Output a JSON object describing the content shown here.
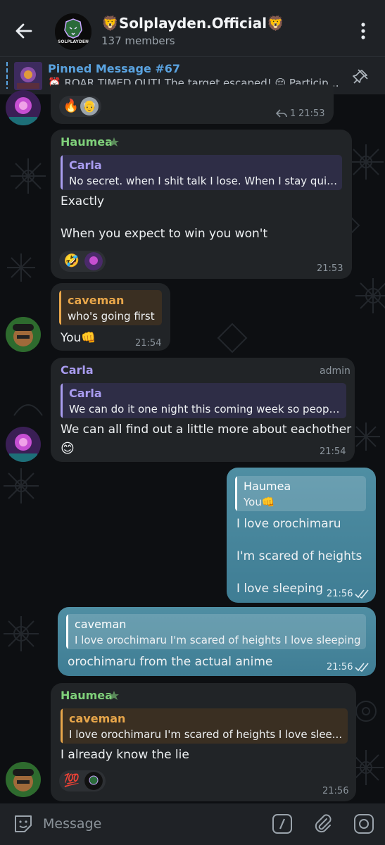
{
  "header": {
    "title": "🦁Solplayden.Official🦁",
    "members": "137 members",
    "logo_text": "SOLPLAYDEN"
  },
  "pinned": {
    "title": "Pinned Message #67",
    "text": "⏰ ROAR TIMED OUT! The target escaped! 😔 Participant..."
  },
  "messages": [
    {
      "id": "m0",
      "reactions": [
        "🔥",
        "👴"
      ],
      "reply_count": "1",
      "time": "21:53"
    },
    {
      "id": "m1",
      "sender": "Haumea",
      "quote_name": "Carla",
      "quote_text": "No secret. when I shit talk I lose. When I stay quiet...",
      "lines": [
        "Exactly",
        "When you expect to win you won't"
      ],
      "reactions": [
        "🤣"
      ],
      "time": "21:53"
    },
    {
      "id": "m2",
      "quote_name": "caveman",
      "quote_text": "who's going first",
      "text": "You👊",
      "time": "21:54"
    },
    {
      "id": "m3",
      "sender": "Carla",
      "badge": "admin",
      "quote_name": "Carla",
      "quote_text": "We can do it one night this coming week so people ha...",
      "lines": [
        "We can all find out a little more about eachother",
        "😊"
      ],
      "time": "21:54"
    },
    {
      "id": "m4",
      "quote_name": "Haumea",
      "quote_text": "You👊",
      "lines": [
        "I love orochimaru",
        "I'm scared of heights",
        "I love sleeping"
      ],
      "time": "21:56"
    },
    {
      "id": "m5",
      "quote_name": "caveman",
      "quote_text": "I love orochimaru  I'm scared of heights  I love sleeping",
      "text": "orochimaru from the actual anime",
      "time": "21:56"
    },
    {
      "id": "m6",
      "sender": "Haumea",
      "quote_name": "caveman",
      "quote_text": "I love orochimaru  I'm scared of heights  I love slee...",
      "text": "I already know the lie",
      "reactions": [
        "💯"
      ],
      "time": "21:56"
    }
  ],
  "input": {
    "placeholder": "Message"
  },
  "colors": {
    "header_bg": "#1f2226",
    "incoming_bubble": "#212427",
    "outgoing_bubble": "#4a889e",
    "sender_haumea": "#7fd07a",
    "sender_carla": "#a99cf0",
    "quote_caveman": "#e8a64a",
    "link": "#5aa3e0"
  }
}
